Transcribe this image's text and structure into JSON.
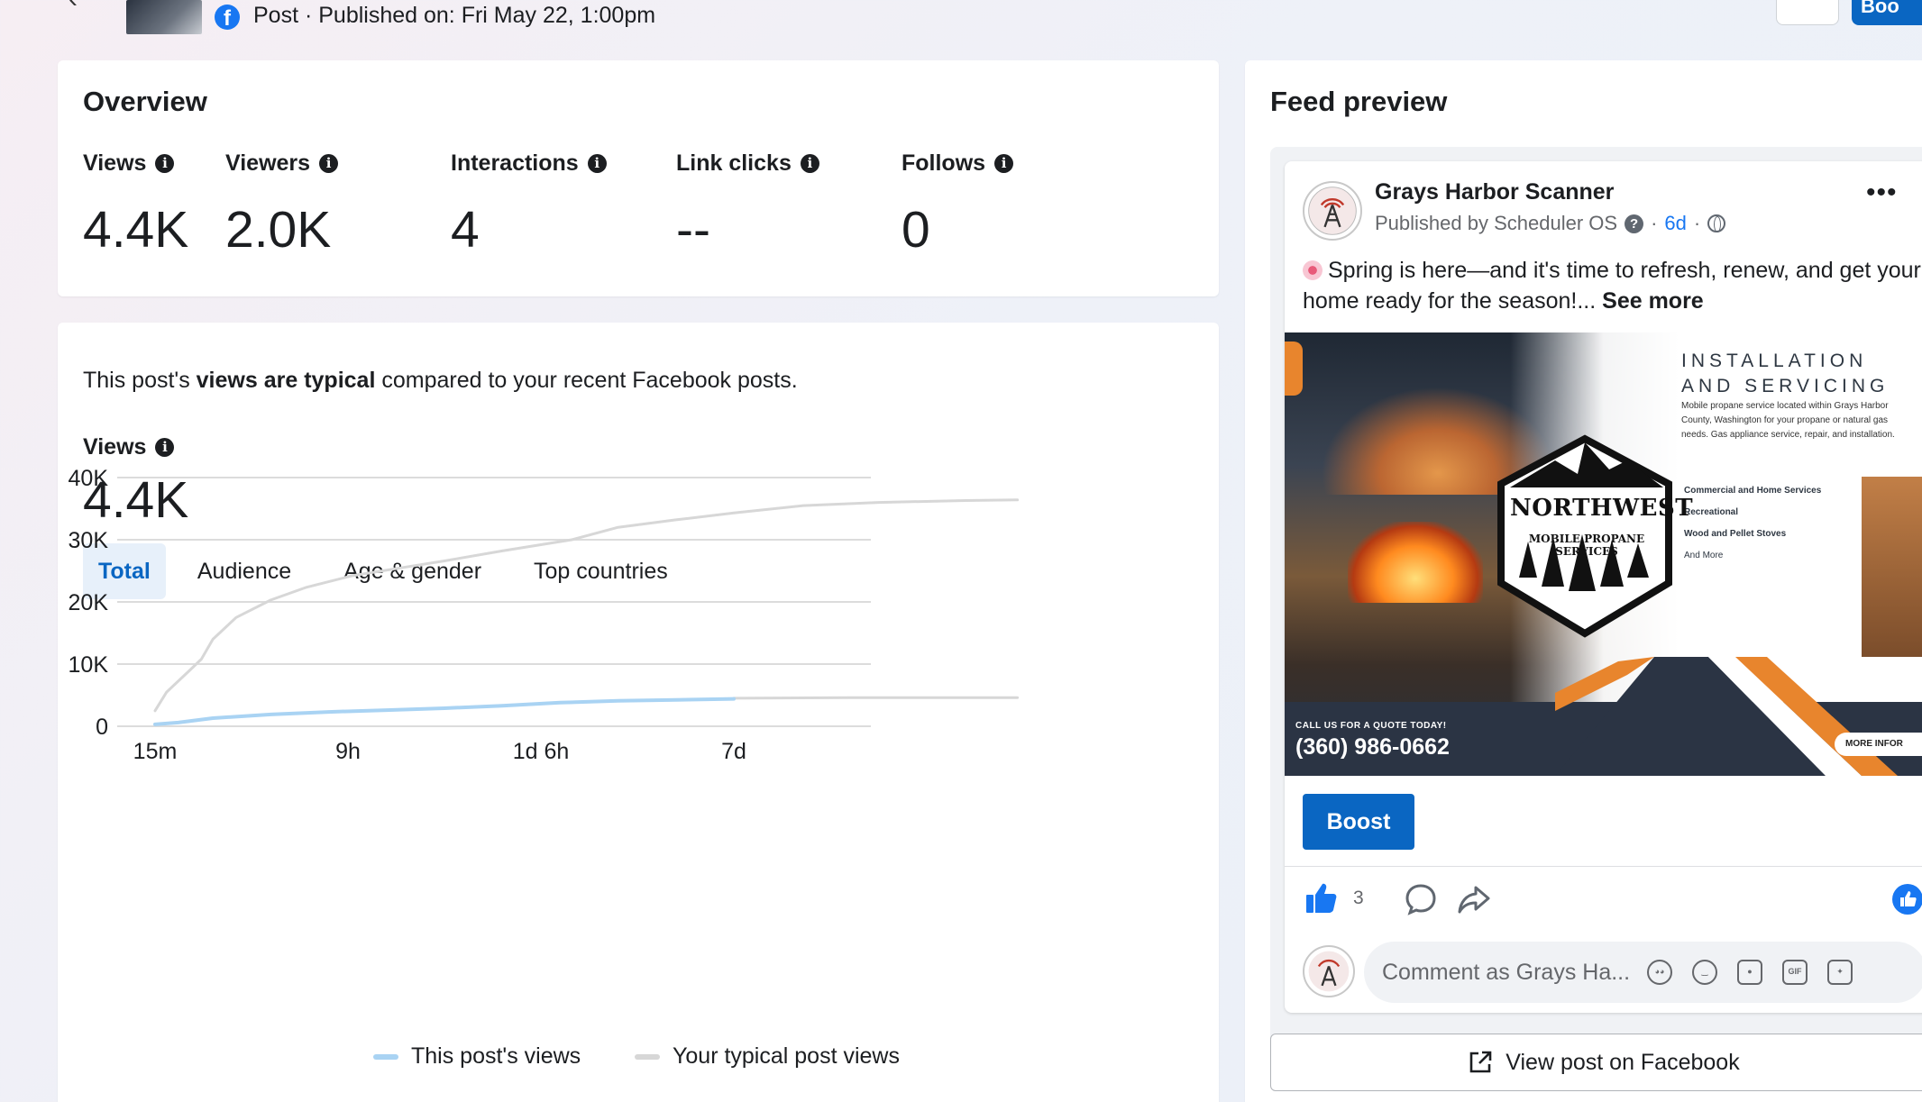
{
  "header": {
    "post_meta": "Post · Published on: Fri May 22, 1:00pm",
    "boost_partial": "Boo"
  },
  "overview": {
    "title": "Overview",
    "metrics": [
      {
        "label": "Views",
        "value": "4.4K"
      },
      {
        "label": "Viewers",
        "value": "2.0K"
      },
      {
        "label": "Interactions",
        "value": "4"
      },
      {
        "label": "Link clicks",
        "value": "--"
      },
      {
        "label": "Follows",
        "value": "0"
      }
    ]
  },
  "views_card": {
    "typical_prefix": "This post's ",
    "typical_bold": "views are typical",
    "typical_suffix": " compared to your recent Facebook posts.",
    "views_label": "Views",
    "views_value": "4.4K",
    "tabs": [
      "Total",
      "Audience",
      "Age & gender",
      "Top countries"
    ],
    "active_tab": "Total"
  },
  "chart_data": {
    "type": "line",
    "x_ticks": [
      "15m",
      "9h",
      "1d 6h",
      "7d"
    ],
    "y_ticks": [
      "0",
      "10K",
      "20K",
      "30K",
      "40K"
    ],
    "ylim": [
      0,
      40000
    ],
    "grid": true,
    "legend_position": "bottom-center",
    "series": [
      {
        "name": "This post's views",
        "color": "#a9d3f3",
        "points": [
          [
            0,
            300
          ],
          [
            0.04,
            600
          ],
          [
            0.1,
            1300
          ],
          [
            0.2,
            1900
          ],
          [
            0.3,
            2300
          ],
          [
            0.4,
            2600
          ],
          [
            0.5,
            2900
          ],
          [
            0.6,
            3300
          ],
          [
            0.7,
            3800
          ],
          [
            0.8,
            4100
          ],
          [
            0.9,
            4250
          ],
          [
            1.0,
            4400
          ]
        ]
      },
      {
        "name": "Your typical post views",
        "color": "#d7d7d7",
        "points": [
          [
            0,
            2500
          ],
          [
            0.02,
            5500
          ],
          [
            0.06,
            9000
          ],
          [
            0.08,
            10800
          ],
          [
            0.1,
            14000
          ],
          [
            0.14,
            17500
          ],
          [
            0.2,
            20300
          ],
          [
            0.26,
            22300
          ],
          [
            0.34,
            24200
          ],
          [
            0.42,
            25400
          ],
          [
            0.5,
            26600
          ],
          [
            0.6,
            28200
          ],
          [
            0.72,
            30000
          ],
          [
            0.8,
            32000
          ],
          [
            0.9,
            33200
          ],
          [
            1.0,
            34300
          ],
          [
            1.12,
            35500
          ],
          [
            1.25,
            36000
          ],
          [
            1.4,
            36300
          ],
          [
            1.49,
            36400
          ]
        ]
      },
      {
        "name": "",
        "color": "#d7d7d7",
        "points": [
          [
            1.0,
            4500
          ],
          [
            1.2,
            4600
          ],
          [
            1.49,
            4600
          ]
        ]
      }
    ]
  },
  "feed": {
    "title": "Feed preview",
    "page_name": "Grays Harbor Scanner",
    "published_by": "Published by Scheduler OS",
    "time": "6d",
    "post_text": "Spring is here—and it's time to refresh, renew, and get your home ready for the season!...",
    "see_more": "See more",
    "ad": {
      "heading_1": "INSTALLATION",
      "heading_2": "AND SERVICING",
      "description": "Mobile propane service located within Grays Harbor County, Washington for your propane or natural gas needs. Gas appliance service, repair, and installation.",
      "list": [
        "Commercial and Home Services",
        "Recreational",
        "Wood and Pellet Stoves"
      ],
      "list_last": "And More",
      "logo_main": "NORTHWEST",
      "logo_sub": "MOBILE PROPANE SERVICES",
      "call_text": "CALL US FOR A QUOTE TODAY!",
      "phone": "(360) 986-0662",
      "more_info": "MORE INFOR"
    },
    "boost_label": "Boost",
    "like_count": "3",
    "comment_placeholder": "Comment as Grays Ha...",
    "gif_label": "GIF",
    "view_on_facebook": "View post on Facebook"
  }
}
